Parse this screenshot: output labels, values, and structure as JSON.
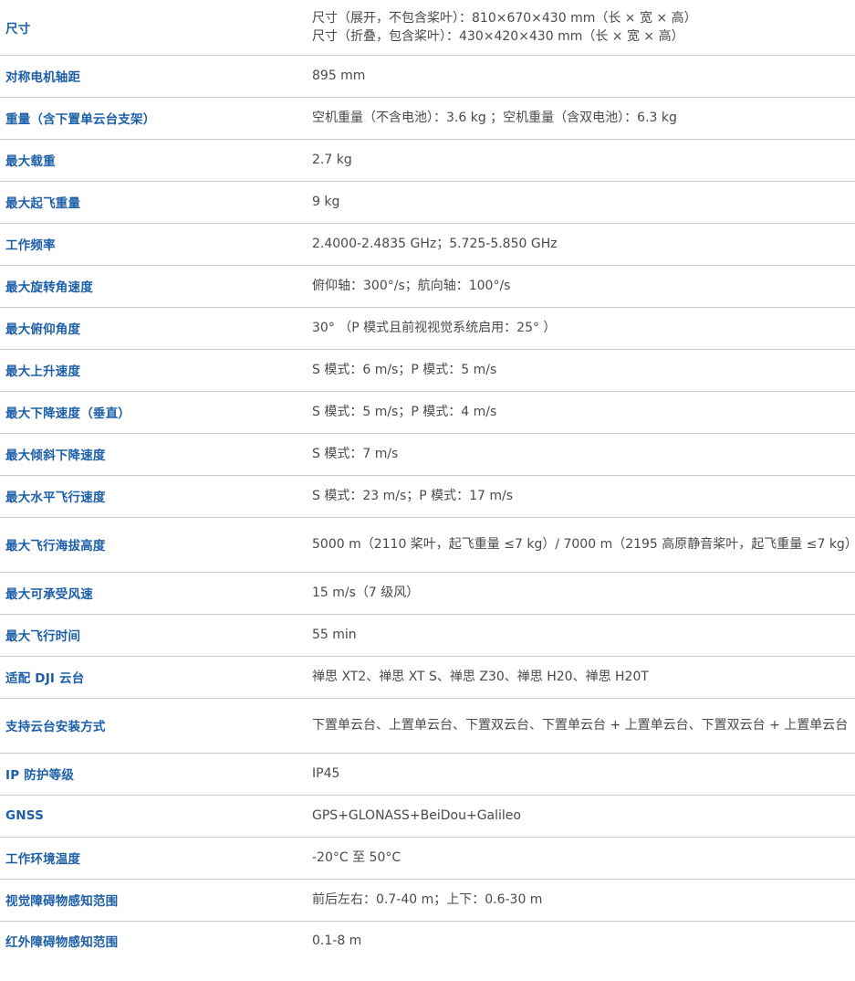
{
  "specs": [
    {
      "label": "尺寸",
      "value_lines": [
        "尺寸（展开，不包含桨叶）：810×670×430 mm（长 × 宽 × 高）",
        "尺寸（折叠，包含桨叶）：430×420×430 mm（长 × 宽 × 高）"
      ]
    },
    {
      "label": "对称电机轴距",
      "value": "895 mm"
    },
    {
      "label": "重量（含下置单云台支架）",
      "value": "空机重量（不含电池）：3.6 kg ；空机重量（含双电池）：6.3 kg"
    },
    {
      "label": "最大载重",
      "value": "2.7 kg"
    },
    {
      "label": "最大起飞重量",
      "value": "9 kg"
    },
    {
      "label": "工作频率",
      "value": "2.4000-2.4835 GHz；5.725-5.850 GHz"
    },
    {
      "label": "最大旋转角速度",
      "value": "俯仰轴：300°/s；航向轴：100°/s"
    },
    {
      "label": "最大俯仰角度",
      "value": "30° （P 模式且前视视觉系统启用：25° ）"
    },
    {
      "label": "最大上升速度",
      "value": "S 模式：6 m/s；P 模式：5 m/s"
    },
    {
      "label": "最大下降速度（垂直）",
      "value": "S 模式：5 m/s；P 模式：4 m/s"
    },
    {
      "label": "最大倾斜下降速度",
      "value": "S 模式：7 m/s"
    },
    {
      "label": "最大水平飞行速度",
      "value": "S 模式：23 m/s；P 模式：17 m/s"
    },
    {
      "label": "最大飞行海拔高度",
      "value": "5000 m（2110 桨叶，起飞重量 ≤7 kg）/ 7000 m（2195 高原静音桨叶，起飞重量 ≤7 kg）"
    },
    {
      "label": "最大可承受风速",
      "value": "15 m/s（7 级风）"
    },
    {
      "label": "最大飞行时间",
      "value": "55 min"
    },
    {
      "label": "适配 DJI 云台",
      "value": "禅思 XT2、禅思 XT S、禅思 Z30、禅思 H20、禅思 H20T"
    },
    {
      "label": "支持云台安装方式",
      "value": "下置单云台、上置单云台、下置双云台、下置单云台 + 上置单云台、下置双云台 + 上置单云台"
    },
    {
      "label": "IP 防护等级",
      "value": "IP45"
    },
    {
      "label": "GNSS",
      "value": "GPS+GLONASS+BeiDou+Galileo"
    },
    {
      "label": "工作环境温度",
      "value": "-20°C 至 50°C"
    },
    {
      "label": "视觉障碍物感知范围",
      "value": "前后左右：0.7-40 m；上下：0.6-30 m"
    },
    {
      "label": "红外障碍物感知范围",
      "value": "0.1-8 m"
    }
  ]
}
